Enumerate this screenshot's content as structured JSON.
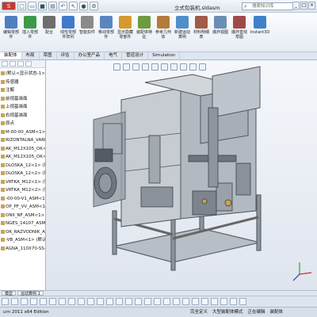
{
  "window": {
    "title": "立式包装机.sldasm",
    "search_placeholder": "搜索知识库"
  },
  "ribbon": {
    "items": [
      {
        "label": "编辑零部件",
        "color": "#4d7fc1"
      },
      {
        "label": "插入零部件",
        "color": "#3e9a4a"
      },
      {
        "label": "配合",
        "color": "#6e6e6e"
      },
      {
        "label": "线性零部件阵列",
        "color": "#3e7ac8"
      },
      {
        "label": "智能扣件",
        "color": "#8a8a8a"
      },
      {
        "label": "移动零部件",
        "color": "#5a86c0"
      },
      {
        "label": "显示隐藏零部件",
        "color": "#d49a2d"
      },
      {
        "label": "装配体特征",
        "color": "#6d9b3e"
      },
      {
        "label": "参考几何体",
        "color": "#b57b3c"
      },
      {
        "label": "新建运动算例",
        "color": "#4f8fc9"
      },
      {
        "label": "材料明细表",
        "color": "#a15b4a"
      },
      {
        "label": "爆炸视图",
        "color": "#6a8fb5"
      },
      {
        "label": "爆炸直线草图",
        "color": "#a14949"
      },
      {
        "label": "Instant3D",
        "color": "#3f82c9"
      }
    ]
  },
  "tabs": [
    "装配体",
    "布局",
    "草图",
    "评估",
    "办公室产品",
    "电气",
    "管道设计",
    "Simulation"
  ],
  "tree": {
    "items": [
      "(默认<显示状态-1>",
      "传感器",
      "注解",
      "前视基准面",
      "上视基准面",
      "右视基准面",
      "原点",
      "M-00-00_ASM<1> (默认",
      "RIZONTALNA_VARILI",
      "AK_M12X105_OK<1>",
      "AK_M12X105_OK<2>",
      "DLOSKA_12<1> (默认",
      "DLOSKA_12<2> (默认",
      "VRTKA_M12<1> (默认",
      "VRTKA_M12<2> (默认",
      "-00-00-V1_ASM<1>",
      "OP_PF_VV_ASM<1>",
      "ONII_NF_ASM<1> (默认",
      "NGES_14107_ASM<1>",
      "OK_RAZVODNIK_ASM",
      "-VB_ASM<1> (默认",
      "AGNA_110X70-SS-BV"
    ]
  },
  "status_tabs": [
    "模型",
    "运动算例 1"
  ],
  "statusbar": {
    "left": "urn 2011 x64 Edition",
    "right": [
      "完全定义",
      "大型装配体模式",
      "正在编辑",
      "装配体"
    ]
  }
}
